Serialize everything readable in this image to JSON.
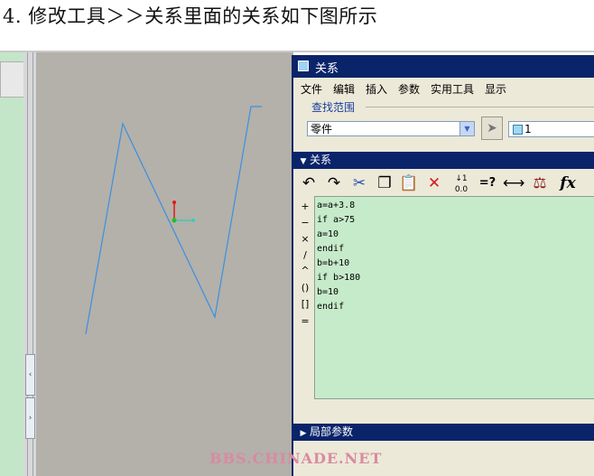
{
  "heading": {
    "text": "4. 修改工具＞＞关系里面的关系如下图所示"
  },
  "dialog": {
    "title": "关系",
    "menu": [
      "文件",
      "编辑",
      "插入",
      "参数",
      "实用工具",
      "显示"
    ],
    "search_scope": {
      "label": "查找范围",
      "selected": "零件",
      "value": "1"
    },
    "relations_section": {
      "title": "关系",
      "toolbar": {
        "undo_icon": "undo-icon",
        "redo_icon": "redo-icon",
        "cut_icon": "scissors-icon",
        "copy_icon": "copy-icon",
        "paste_icon": "paste-icon",
        "delete_icon": "delete-x-icon",
        "sort_icon": "sort-relations-icon",
        "verify_label": "=?",
        "measure_icon": "dimension-icon",
        "units_icon": "units-icon",
        "function_label": "fx",
        "sort_text": "0.0"
      },
      "operators": [
        "+",
        "−",
        "×",
        "/",
        "^",
        "()",
        "[]",
        "="
      ],
      "lines": [
        "a=a+3.8",
        "if a>75",
        "a=10",
        "endif",
        "b=b+10",
        "if b>180",
        "b=10",
        "endif"
      ]
    },
    "local_params_section": {
      "title": "局部参数"
    }
  },
  "watermark": "BBS.CHINADE.NET",
  "colors": {
    "titlebar": "#0a246a",
    "editor_bg": "#c6ebca",
    "canvas_bg": "#b3b1a9",
    "sketch_line": "#3d8ee6"
  }
}
